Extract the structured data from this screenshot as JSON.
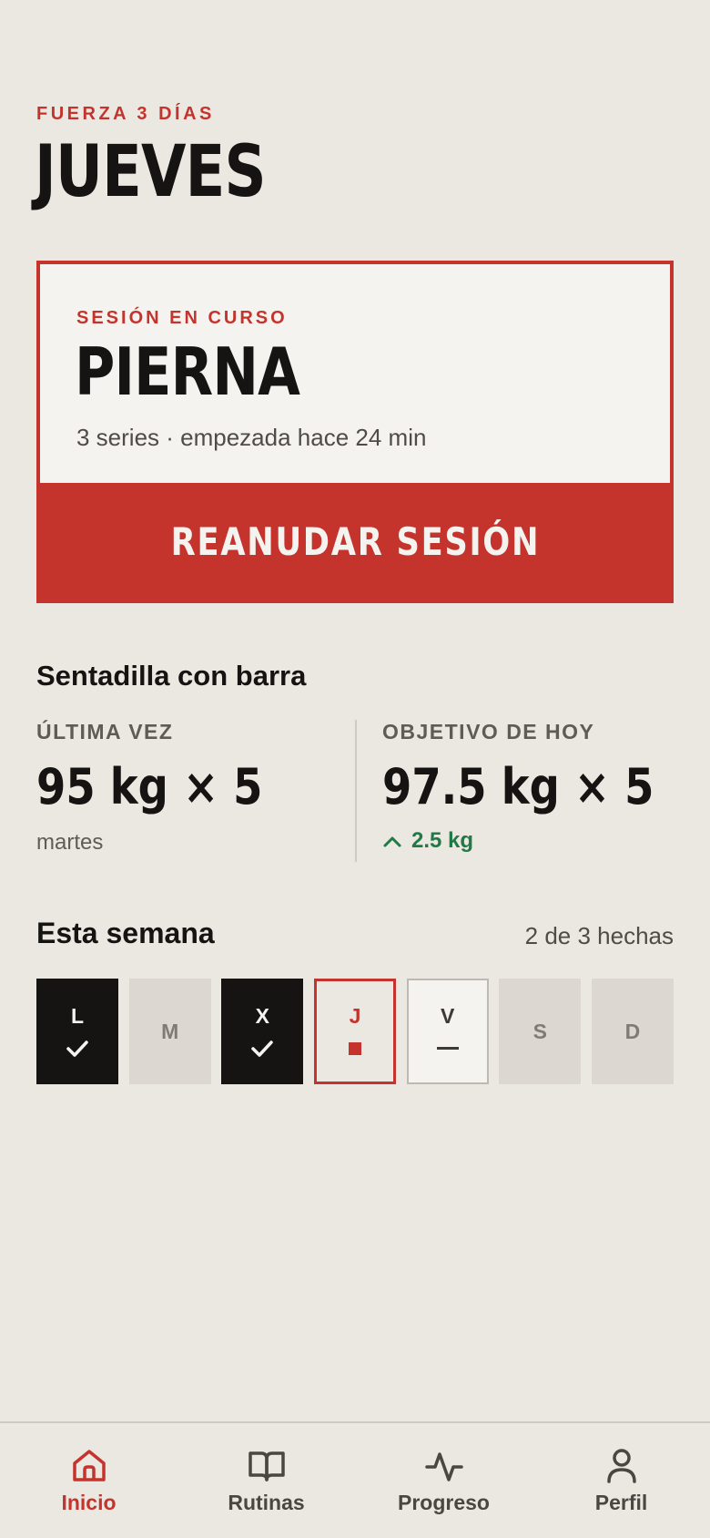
{
  "header": {
    "program": "FUERZA 3 DÍAS",
    "day": "JUEVES"
  },
  "session": {
    "tag": "SESIÓN EN CURSO",
    "name": "PIERNA",
    "meta": "3 series · empezada hace 24 min",
    "button_label": "REANUDAR SESIÓN"
  },
  "exercise": {
    "name": "Sentadilla con barra",
    "last": {
      "label": "ÚLTIMA VEZ",
      "value": "95 kg × 5",
      "day": "martes"
    },
    "target": {
      "label": "OBJETIVO DE HOY",
      "value": "97.5 kg × 5",
      "delta": "2.5 kg",
      "delta_icon": "chevron-up-icon"
    }
  },
  "week": {
    "title": "Esta semana",
    "count": "2 de 3 hechas",
    "days": [
      {
        "letter": "L",
        "state": "done"
      },
      {
        "letter": "M",
        "state": "rest"
      },
      {
        "letter": "X",
        "state": "done"
      },
      {
        "letter": "J",
        "state": "today"
      },
      {
        "letter": "V",
        "state": "planned"
      },
      {
        "letter": "S",
        "state": "rest"
      },
      {
        "letter": "D",
        "state": "rest"
      }
    ]
  },
  "tabs": [
    {
      "label": "Inicio",
      "icon": "home-icon",
      "active": true
    },
    {
      "label": "Rutinas",
      "icon": "book-icon",
      "active": false
    },
    {
      "label": "Progreso",
      "icon": "activity-icon",
      "active": false
    },
    {
      "label": "Perfil",
      "icon": "user-icon",
      "active": false
    }
  ],
  "colors": {
    "accent": "#c4342d",
    "background": "#ebe7e1",
    "card": "#f5f3ef",
    "ink": "#151412",
    "positive": "#1f7a45"
  }
}
